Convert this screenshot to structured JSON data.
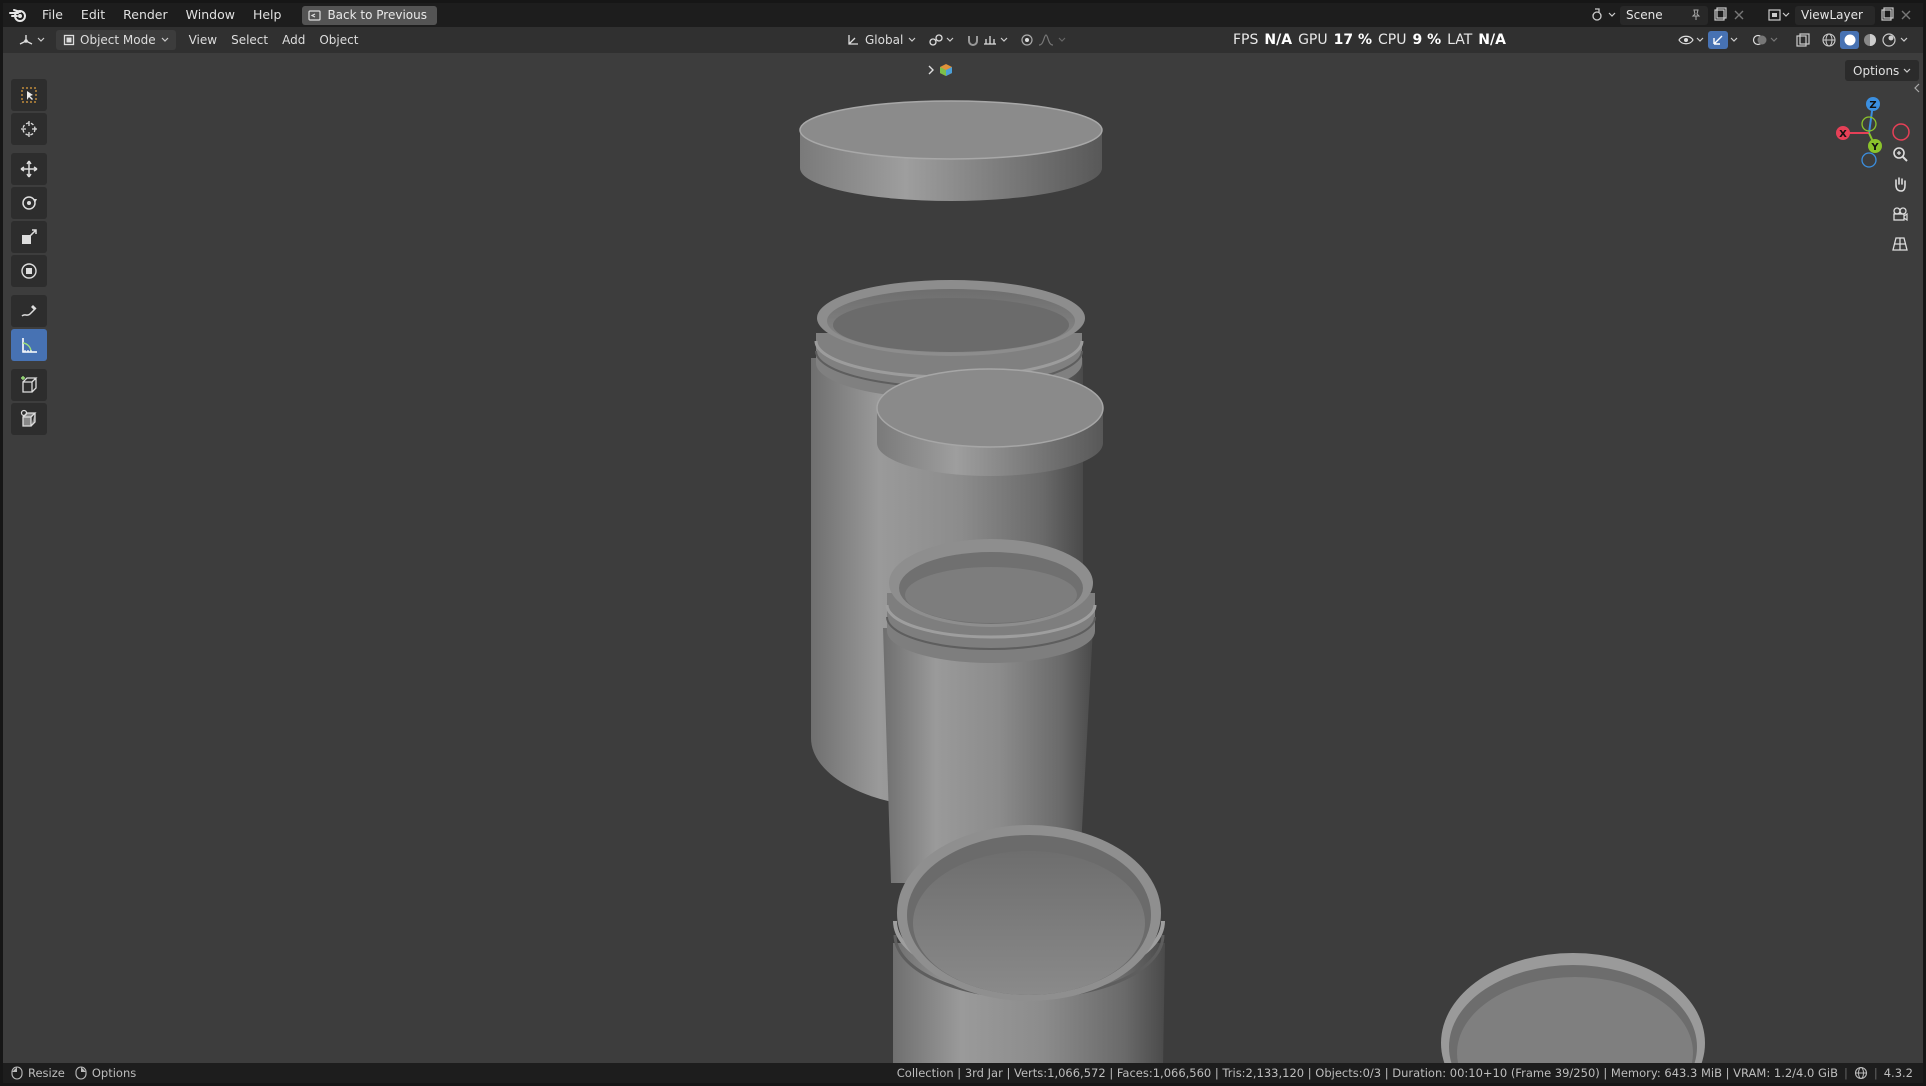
{
  "topbar": {
    "menu": [
      "File",
      "Edit",
      "Render",
      "Window",
      "Help"
    ],
    "back_button": "Back to Previous",
    "scene_field": "Scene",
    "view_layer_field": "ViewLayer"
  },
  "header": {
    "mode": "Object Mode",
    "menus": [
      "View",
      "Select",
      "Add",
      "Object"
    ],
    "transform_orientation": "Global",
    "options_label": "Options"
  },
  "stats": {
    "fps_label": "FPS",
    "fps_value": "N/A",
    "gpu_label": "GPU",
    "gpu_value": "17 %",
    "cpu_label": "CPU",
    "cpu_value": "9 %",
    "lat_label": "LAT",
    "lat_value": "N/A"
  },
  "gizmo": {
    "z": "Z",
    "y": "Y",
    "x": "X"
  },
  "statusbar": {
    "left_1": "Resize",
    "left_2": "Options",
    "info": "Collection | 3rd Jar | Verts:1,066,572 | Faces:1,066,560 | Tris:2,133,120 | Objects:0/3 | Duration: 00:10+10 (Frame 39/250) | Memory: 643.3 MiB | VRAM: 1.2/4.0 GiB",
    "version": "4.3.2"
  },
  "colors": {
    "accent": "#4772b3",
    "axis_x": "#e64057",
    "axis_y": "#8bc42b",
    "axis_z": "#3b8fe0"
  }
}
